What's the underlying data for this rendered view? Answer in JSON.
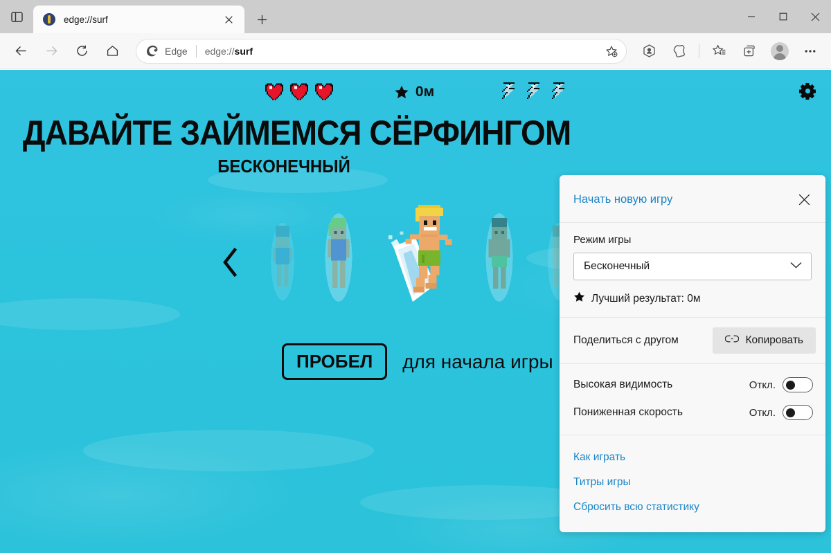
{
  "window": {
    "minimize_label": "Свернуть",
    "maximize_label": "Развернуть",
    "close_label": "Закрыть"
  },
  "tabstrip": {
    "tab_search_icon": "tab-search-icon",
    "tabs": [
      {
        "title": "edge://surf",
        "favicon": "surfboard-icon",
        "close_icon": "close-icon"
      }
    ],
    "new_tab_label": "+"
  },
  "toolbar": {
    "back_icon": "back-arrow-icon",
    "forward_icon": "forward-arrow-icon",
    "refresh_icon": "refresh-icon",
    "home_icon": "home-icon",
    "omnibox": {
      "brand_label": "Edge",
      "url_prefix": "edge://",
      "url_bold": "surf",
      "full_url": "edge://surf",
      "favorite_icon": "add-favorite-icon"
    },
    "right_icons": [
      {
        "name": "copilot-icon"
      },
      {
        "name": "split-screen-icon"
      },
      {
        "name": "favorites-icon"
      },
      {
        "name": "collections-icon"
      },
      {
        "name": "profile-avatar"
      },
      {
        "name": "settings-more-icon"
      }
    ]
  },
  "game": {
    "title": "ДАВАЙТЕ ЗАЙМЕМСЯ СЁРФИНГОМ",
    "subtitle": "БЕСКОНЕЧНЫЙ",
    "hud": {
      "hearts": 3,
      "hearts_icon": "heart-icon",
      "score_icon": "star-icon",
      "score": "0м",
      "bolts": 3,
      "bolts_icon": "lightning-bolt-icon"
    },
    "gear_icon": "gear-icon",
    "carousel": {
      "prev_icon": "chevron-left-icon"
    },
    "start": {
      "key_label": "ПРОБЕЛ",
      "hint": "для начала игры"
    },
    "background_color": "#2cc3dd"
  },
  "panel": {
    "new_game_label": "Начать новую игру",
    "close_icon": "close-icon",
    "mode_label": "Режим игры",
    "mode_value": "Бесконечный",
    "mode_chevron_icon": "chevron-down-icon",
    "best_score_icon": "star-icon",
    "best_score_label": "Лучший результат: 0м",
    "share_label": "Поделиться с другом",
    "copy_button_label": "Копировать",
    "copy_icon": "link-icon",
    "toggles": [
      {
        "label": "Высокая видимость",
        "state": "Откл.",
        "on": false
      },
      {
        "label": "Пониженная скорость",
        "state": "Откл.",
        "on": false
      }
    ],
    "links": [
      {
        "label": "Как играть"
      },
      {
        "label": "Титры игры"
      },
      {
        "label": "Сбросить всю статистику"
      }
    ],
    "accent_color": "#1a84c7"
  }
}
